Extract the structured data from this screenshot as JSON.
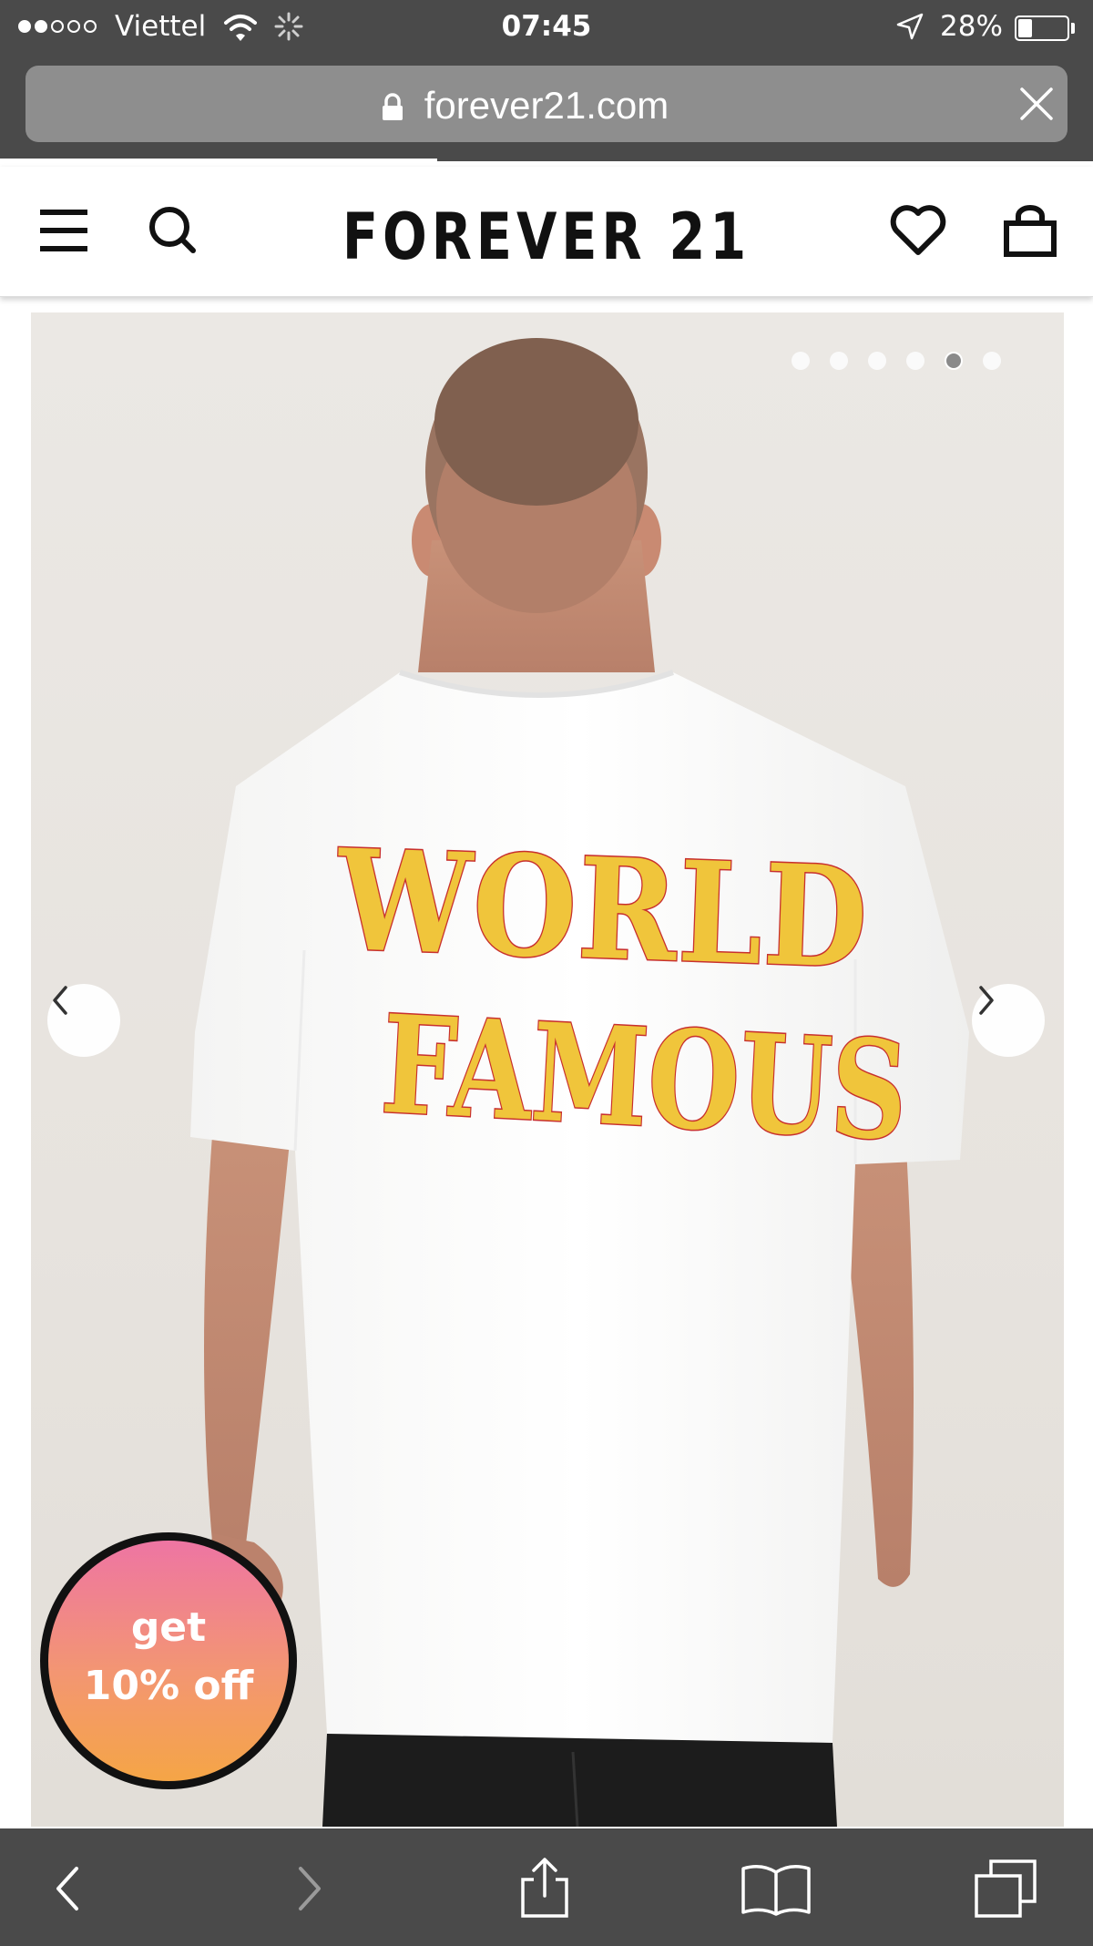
{
  "status_bar": {
    "carrier": "Viettel",
    "signal_bars_filled": 2,
    "signal_bars_total": 5,
    "time": "07:45",
    "battery_percent": "28%",
    "battery_level": 0.28,
    "icons": [
      "wifi-icon",
      "activity-spinner-icon",
      "location-arrow-icon",
      "battery-icon"
    ]
  },
  "browser": {
    "url": "forever21.com",
    "page_load_progress": 0.4,
    "toolbar": [
      "back-icon",
      "forward-icon",
      "share-icon",
      "bookmarks-icon",
      "tabs-icon"
    ]
  },
  "site_header": {
    "logo": "FOREVER 21",
    "icons": [
      "menu-icon",
      "search-icon",
      "heart-icon",
      "shopping-bag-icon"
    ]
  },
  "gallery": {
    "slide_count": 6,
    "active_slide_index": 4,
    "shirt_print": [
      "WORLD",
      "FAMOUS"
    ],
    "shirt_print_color": "#f0c53b",
    "shirt_outline_color": "#c8302e"
  },
  "promo": {
    "line1": "get",
    "line2": "10% off",
    "gradient": [
      "#ee75a3",
      "#f39672",
      "#f5a546"
    ]
  },
  "colors": {
    "chrome": "#4a4a4a",
    "url_pill": "#8e8e8e"
  }
}
